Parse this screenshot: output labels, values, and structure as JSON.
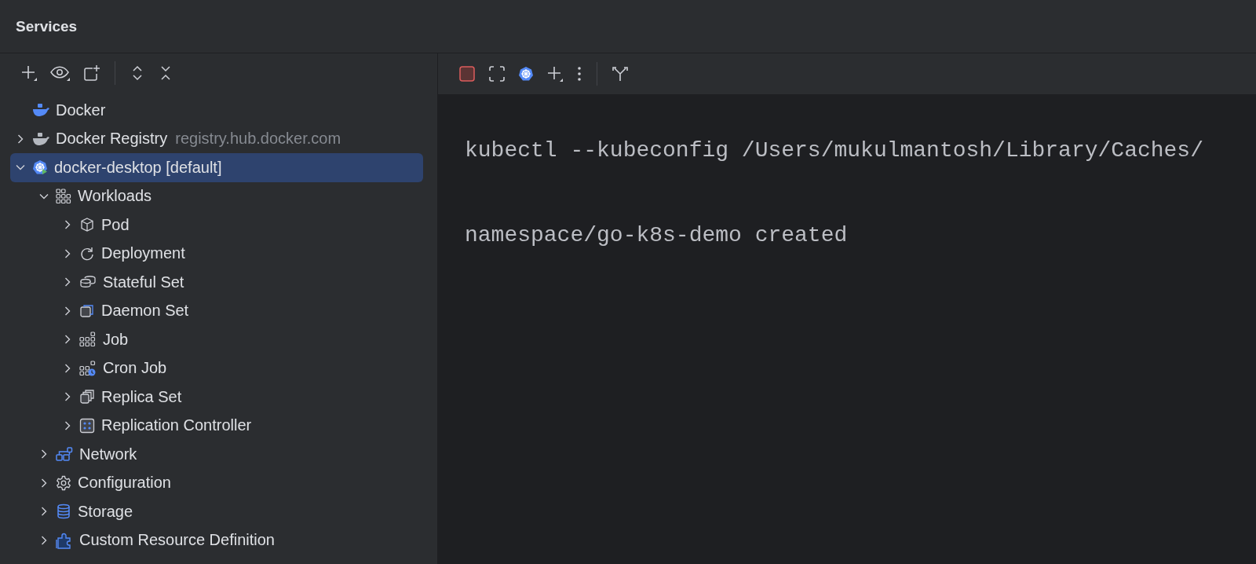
{
  "window": {
    "title": "Services"
  },
  "left_toolbar": [
    {
      "kind": "add"
    },
    {
      "kind": "eye"
    },
    {
      "kind": "new-tab"
    },
    {
      "kind": "separator"
    },
    {
      "kind": "expand"
    },
    {
      "kind": "collapse"
    }
  ],
  "tree": [
    {
      "label": "Docker",
      "kind": "docker",
      "selected": false
    },
    {
      "label": "Docker Registry",
      "detail": "registry.hub.docker.com",
      "kind": "registry",
      "expanded": false,
      "selected": false
    },
    {
      "label": "docker-desktop [default]",
      "kind": "kubernetes",
      "expanded": true,
      "selected": true,
      "children": [
        {
          "label": "Workloads",
          "kind": "workloads",
          "expanded": true,
          "selected": false,
          "children": [
            {
              "label": "Pod",
              "kind": "pod",
              "expanded": false,
              "selected": false
            },
            {
              "label": "Deployment",
              "kind": "deployment",
              "expanded": false,
              "selected": false
            },
            {
              "label": "Stateful Set",
              "kind": "statefulset",
              "expanded": false,
              "selected": false
            },
            {
              "label": "Daemon Set",
              "kind": "daemonset",
              "expanded": false,
              "selected": false
            },
            {
              "label": "Job",
              "kind": "job",
              "expanded": false,
              "selected": false
            },
            {
              "label": "Cron Job",
              "kind": "cronjob",
              "expanded": false,
              "selected": false
            },
            {
              "label": "Replica Set",
              "kind": "replicaset",
              "expanded": false,
              "selected": false
            },
            {
              "label": "Replication Controller",
              "kind": "replicationcontroller",
              "expanded": false,
              "selected": false
            }
          ]
        },
        {
          "label": "Network",
          "kind": "network",
          "expanded": false,
          "selected": false
        },
        {
          "label": "Configuration",
          "kind": "configuration",
          "expanded": false,
          "selected": false
        },
        {
          "label": "Storage",
          "kind": "storage",
          "expanded": false,
          "selected": false
        },
        {
          "label": "Custom Resource Definition",
          "kind": "crd",
          "expanded": false,
          "selected": false
        }
      ]
    }
  ],
  "right_toolbar": [
    {
      "kind": "stop"
    },
    {
      "kind": "fullscreen"
    },
    {
      "kind": "kubernetes"
    },
    {
      "kind": "add"
    },
    {
      "kind": "more"
    },
    {
      "kind": "separator"
    },
    {
      "kind": "fork"
    }
  ],
  "console": {
    "lines": [
      "kubectl --kubeconfig /Users/mukulmantosh/Library/Caches/",
      "namespace/go-k8s-demo created"
    ]
  }
}
